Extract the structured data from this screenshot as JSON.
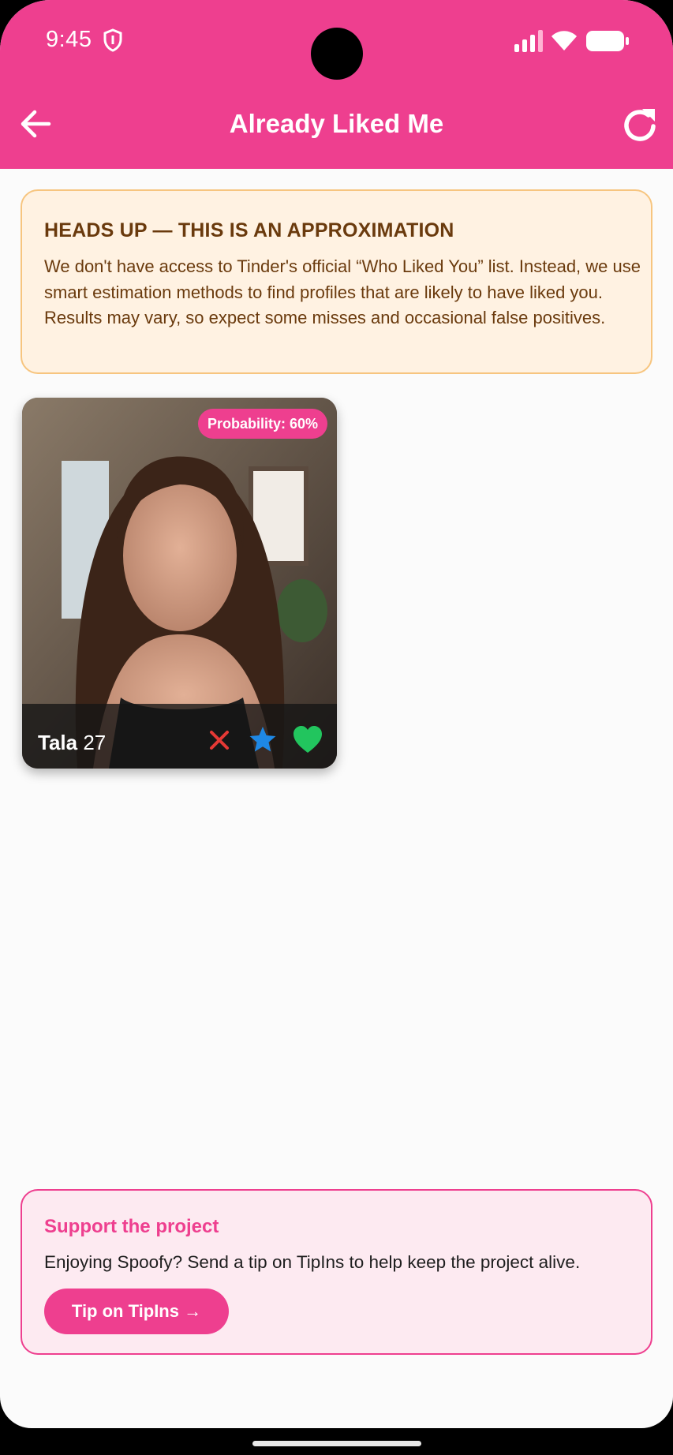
{
  "status_bar": {
    "time": "9:45"
  },
  "header": {
    "title": "Already Liked Me"
  },
  "notice": {
    "title": "HEADS UP — THIS IS AN APPROXIMATION",
    "body": "We don't have access to Tinder's official “Who Liked You” list. Instead, we use smart estimation methods to find profiles that are likely to have liked you. Results may vary, so expect some misses and occasional false positives."
  },
  "profiles": [
    {
      "name": "Tala",
      "age": "27",
      "probability": "Probability: 60%"
    }
  ],
  "support": {
    "title": "Support the project",
    "body": "Enjoying Spoofy? Send a tip on TipIns to help keep the project alive.",
    "button_label": "Tip on TipIns →"
  },
  "colors": {
    "brand_pink": "#ee3f8f",
    "notice_bg": "#fff2e2",
    "notice_text": "#6a3a0d",
    "pass": "#e53935",
    "superlike": "#1e88e5",
    "like": "#22c55e"
  }
}
